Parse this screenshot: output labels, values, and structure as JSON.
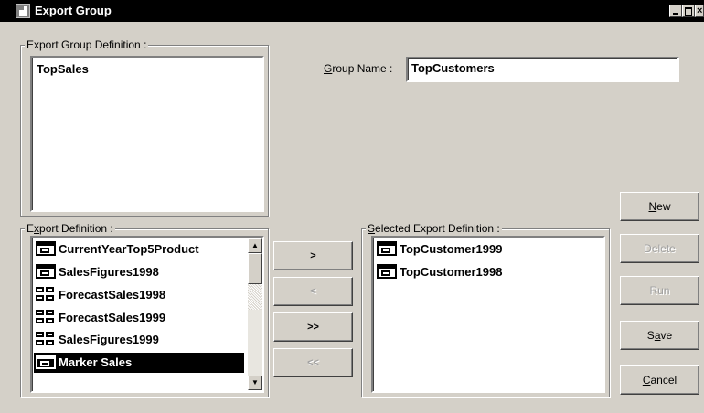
{
  "window": {
    "title": "Export Group",
    "min_symbol": "",
    "max_symbol": "",
    "close_symbol": "×"
  },
  "group_definition": {
    "legend": "Export Group Definition :",
    "items": [
      "TopSales"
    ]
  },
  "group_name": {
    "label_accel": "G",
    "label_rest": "roup Name :",
    "value": "TopCustomers"
  },
  "export_definition": {
    "legend_pre": "E",
    "legend_accel": "x",
    "legend_post": "port Definition :",
    "items": [
      {
        "label": "CurrentYearTop5Product",
        "icon": "window-icon"
      },
      {
        "label": "SalesFigures1998",
        "icon": "window-icon"
      },
      {
        "label": "ForecastSales1998",
        "icon": "grid-icon"
      },
      {
        "label": "ForecastSales1999",
        "icon": "grid-icon"
      },
      {
        "label": "SalesFigures1999",
        "icon": "grid-icon"
      },
      {
        "label": "Marker Sales",
        "icon": "window-icon",
        "selected": true
      }
    ]
  },
  "selected_export_definition": {
    "legend_accel": "S",
    "legend_rest": "elected Export Definition :",
    "items": [
      {
        "label": "TopCustomer1999",
        "icon": "window-icon"
      },
      {
        "label": "TopCustomer1998",
        "icon": "window-icon"
      }
    ]
  },
  "transfer_buttons": {
    "add": ">",
    "remove": "<",
    "add_all": ">>",
    "remove_all": "<<"
  },
  "action_buttons": {
    "new_accel": "N",
    "new_rest": "ew",
    "delete": "Delete",
    "run": "Run",
    "save_pre": "S",
    "save_accel": "a",
    "save_post": "ve",
    "cancel_accel": "C",
    "cancel_rest": "ancel"
  }
}
